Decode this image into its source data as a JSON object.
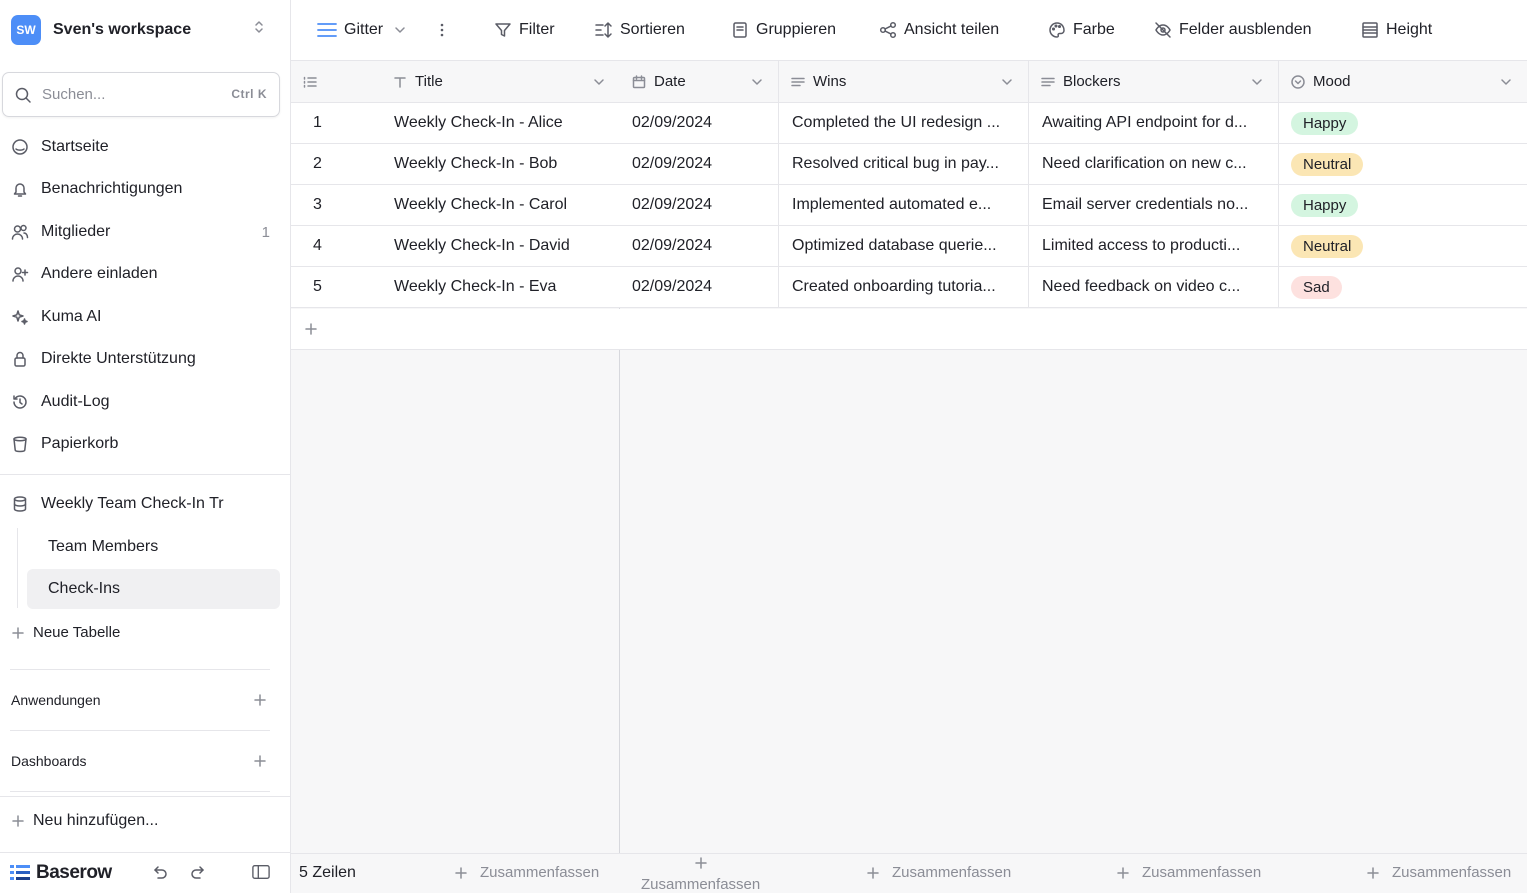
{
  "workspace": {
    "initials": "SW",
    "name": "Sven's workspace"
  },
  "search": {
    "placeholder": "Suchen...",
    "shortcut": "Ctrl  K"
  },
  "nav": [
    {
      "label": "Startseite",
      "icon": "home-icon"
    },
    {
      "label": "Benachrichtigungen",
      "icon": "bell-icon"
    },
    {
      "label": "Mitglieder",
      "icon": "users-icon",
      "count": "1"
    },
    {
      "label": "Andere einladen",
      "icon": "user-plus-icon"
    },
    {
      "label": "Kuma AI",
      "icon": "sparkle-icon"
    },
    {
      "label": "Direkte Unterstützung",
      "icon": "lock-icon"
    },
    {
      "label": "Audit-Log",
      "icon": "history-icon"
    },
    {
      "label": "Papierkorb",
      "icon": "trash-icon"
    }
  ],
  "database": {
    "name": "Weekly Team Check-In Tr",
    "tables": [
      {
        "label": "Team Members",
        "active": false
      },
      {
        "label": "Check-Ins",
        "active": true
      }
    ],
    "new_table": "Neue Tabelle"
  },
  "sections": {
    "applications": "Anwendungen",
    "dashboards": "Dashboards"
  },
  "add_new": "Neu hinzufügen...",
  "brand": "Baserow",
  "toolbar": {
    "view": "Gitter",
    "filter": "Filter",
    "sort": "Sortieren",
    "group": "Gruppieren",
    "share": "Ansicht teilen",
    "color": "Farbe",
    "hide_fields": "Felder ausblenden",
    "height": "Height"
  },
  "columns": {
    "title": "Title",
    "date": "Date",
    "wins": "Wins",
    "blockers": "Blockers",
    "mood": "Mood"
  },
  "rows": [
    {
      "id": "1",
      "title": "Weekly Check-In - Alice",
      "date": "02/09/2024",
      "wins": "Completed the UI redesign ...",
      "blockers": "Awaiting API endpoint for d...",
      "mood": "Happy"
    },
    {
      "id": "2",
      "title": "Weekly Check-In - Bob",
      "date": "02/09/2024",
      "wins": "Resolved critical bug in pay...",
      "blockers": "Need clarification on new c...",
      "mood": "Neutral"
    },
    {
      "id": "3",
      "title": "Weekly Check-In - Carol",
      "date": "02/09/2024",
      "wins": "Implemented automated e...",
      "blockers": "Email server credentials no...",
      "mood": "Happy"
    },
    {
      "id": "4",
      "title": "Weekly Check-In - David",
      "date": "02/09/2024",
      "wins": "Optimized database querie...",
      "blockers": "Limited access to producti...",
      "mood": "Neutral"
    },
    {
      "id": "5",
      "title": "Weekly Check-In - Eva",
      "date": "02/09/2024",
      "wins": "Created onboarding tutoria...",
      "blockers": "Need feedback on video c...",
      "mood": "Sad"
    }
  ],
  "mood_colors": {
    "Happy": "#d4f5e0",
    "Neutral": "#fbe6b4",
    "Sad": "#fde1df"
  },
  "footer": {
    "row_count": "5 Zeilen",
    "summarize": "Zusammenfassen"
  },
  "colors": {
    "accent": "#4d8ef7",
    "border": "#e6e6ea"
  }
}
